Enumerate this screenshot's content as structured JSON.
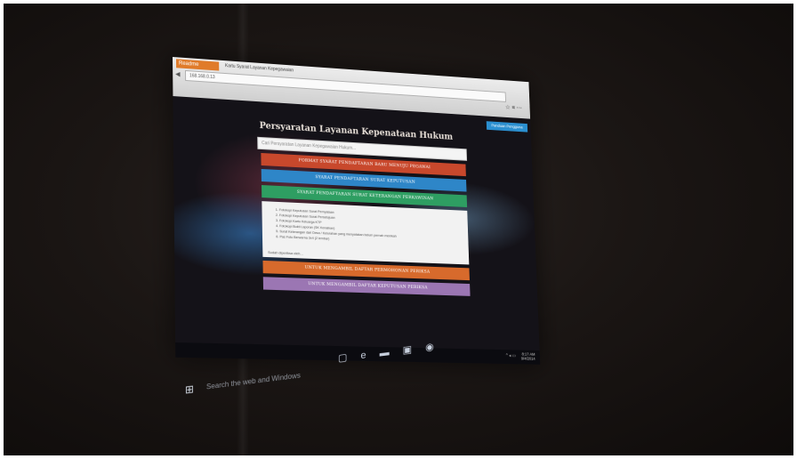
{
  "browser": {
    "tab_label": "Readme",
    "tab_title": "Kartu Syarat Layanan Kepegawaian",
    "url": "168.168.0.13",
    "back_glyph": "◀",
    "extension_glyphs": "☆ ≡ ⋯"
  },
  "page": {
    "top_button": "Panduan Pengguna",
    "title": "Persyaratan Layanan Kepenataan Hukum",
    "search_placeholder": "Cari Persyaratan Layanan Kepegawaian Hukum...",
    "bands": [
      {
        "label": "FORMAT SYARAT PENDAFTARAN BARU MENUJU PEGAWAI",
        "color": "#c8482c"
      },
      {
        "label": "SYARAT PENDAFTARAN SURAT KEPUTUSAN",
        "color": "#2e86c8"
      },
      {
        "label": "SYARAT PENDAFTARAN SURAT KETERANGAN PERKAWINAN",
        "color": "#2e9e62"
      }
    ],
    "content_items": [
      "Fotokopi Keputusan Surat Pernyataan",
      "Fotokopi Keputusan Surat Persetujuan",
      "Fotokopi Kartu Keluarga KTP",
      "Fotokopi Bukti Laporan (SK Kenaikan)",
      "Surat Keterangan dari Desa / Kelurahan yang menyatakan belum pernah menikah",
      "Pas Foto Berwarna 3x4 (2 lembar)"
    ],
    "content_note": "Sudah diperiksa oleh...",
    "bottom_bands": [
      {
        "label": "UNTUK MENGAMBIL DAFTAR PERMOHONAN PERIKSA",
        "color": "#d76a2c"
      },
      {
        "label": "UNTUK MENGAMBIL DAFTAR KEPUTUSAN PERIKSA",
        "color": "#9b76b3"
      }
    ]
  },
  "taskbar": {
    "windows_logo": "⊞",
    "search_text": "Search the web and Windows",
    "icons": "▢ e ▬ ▣ ◉",
    "tray": "^ ◂ ▭",
    "clock_time": "8:17 AM",
    "clock_date": "9/4/2014"
  }
}
